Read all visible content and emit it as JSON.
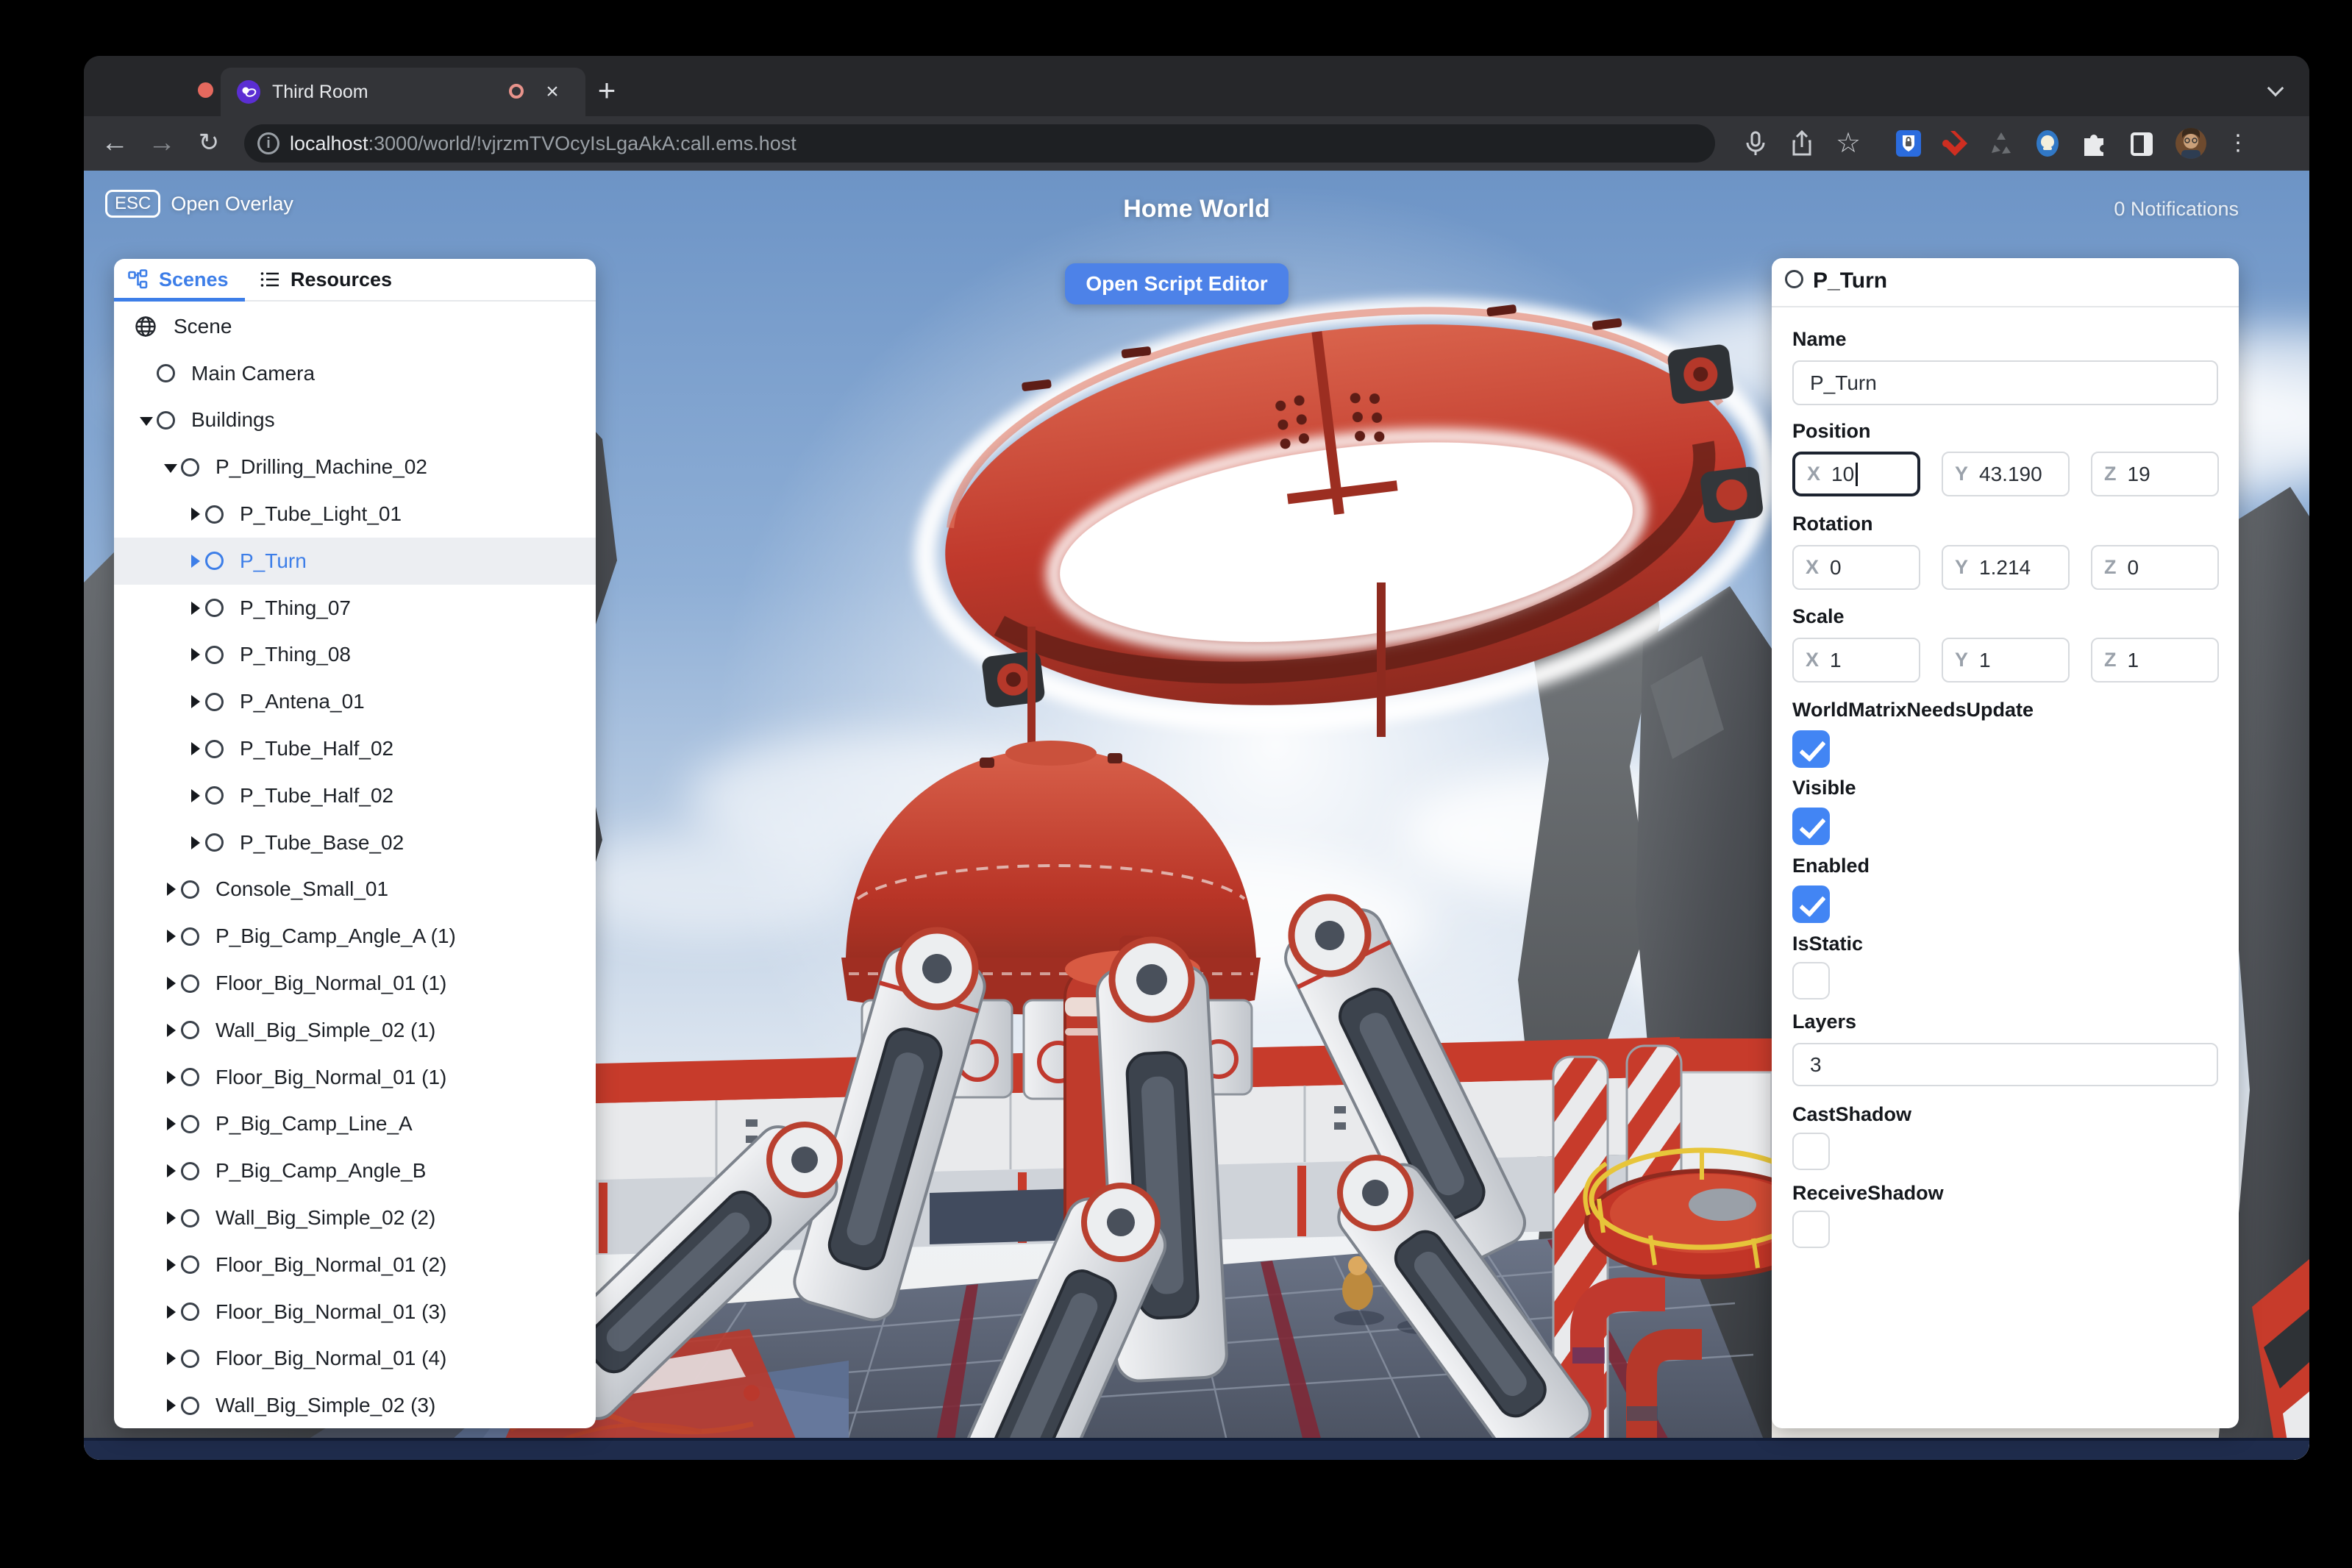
{
  "browser": {
    "tab_title": "Third Room",
    "close_tab_glyph": "×",
    "new_tab_glyph": "+",
    "back_glyph": "←",
    "forward_glyph": "→",
    "reload_glyph": "↻",
    "info_glyph": "i",
    "url_host": "localhost",
    "url_rest": ":3000/world/!vjrzmTVOcyIsLgaAkA:call.ems.host",
    "kebab_glyph": "⋮",
    "star_glyph": "☆",
    "toolbar_icon_names": [
      "microphone-icon",
      "share-icon",
      "bookmark-star-icon",
      "password-manager-icon",
      "red-extension-icon",
      "recycle-icon",
      "dark-mode-icon",
      "puzzle-extensions-icon",
      "side-panel-icon",
      "profile-avatar",
      "menu-kebab-icon"
    ]
  },
  "hud": {
    "esc_key": "ESC",
    "open_overlay_label": "Open Overlay",
    "world_title": "Home World",
    "notifications": "0 Notifications",
    "open_script_editor": "Open Script Editor"
  },
  "panel_tabs": {
    "scenes": "Scenes",
    "resources": "Resources"
  },
  "scene_tree": [
    {
      "label": "Scene",
      "level": 0,
      "icon": "globe",
      "caret": "none",
      "selected": false
    },
    {
      "label": "Main Camera",
      "level": 1,
      "caret": "none",
      "selected": false
    },
    {
      "label": "Buildings",
      "level": 1,
      "caret": "down",
      "selected": false
    },
    {
      "label": "P_Drilling_Machine_02",
      "level": 2,
      "caret": "down",
      "selected": false
    },
    {
      "label": "P_Tube_Light_01",
      "level": 3,
      "caret": "right",
      "selected": false
    },
    {
      "label": "P_Turn",
      "level": 3,
      "caret": "right",
      "selected": true
    },
    {
      "label": "P_Thing_07",
      "level": 3,
      "caret": "right",
      "selected": false
    },
    {
      "label": "P_Thing_08",
      "level": 3,
      "caret": "right",
      "selected": false
    },
    {
      "label": "P_Antena_01",
      "level": 3,
      "caret": "right",
      "selected": false
    },
    {
      "label": "P_Tube_Half_02",
      "level": 3,
      "caret": "right",
      "selected": false
    },
    {
      "label": "P_Tube_Half_02",
      "level": 3,
      "caret": "right",
      "selected": false
    },
    {
      "label": "P_Tube_Base_02",
      "level": 3,
      "caret": "right",
      "selected": false
    },
    {
      "label": "Console_Small_01",
      "level": 2,
      "caret": "right",
      "selected": false
    },
    {
      "label": "P_Big_Camp_Angle_A (1)",
      "level": 2,
      "caret": "right",
      "selected": false
    },
    {
      "label": "Floor_Big_Normal_01 (1)",
      "level": 2,
      "caret": "right",
      "selected": false
    },
    {
      "label": "Wall_Big_Simple_02 (1)",
      "level": 2,
      "caret": "right",
      "selected": false
    },
    {
      "label": "Floor_Big_Normal_01 (1)",
      "level": 2,
      "caret": "right",
      "selected": false
    },
    {
      "label": "P_Big_Camp_Line_A",
      "level": 2,
      "caret": "right",
      "selected": false
    },
    {
      "label": "P_Big_Camp_Angle_B",
      "level": 2,
      "caret": "right",
      "selected": false
    },
    {
      "label": "Wall_Big_Simple_02 (2)",
      "level": 2,
      "caret": "right",
      "selected": false
    },
    {
      "label": "Floor_Big_Normal_01 (2)",
      "level": 2,
      "caret": "right",
      "selected": false
    },
    {
      "label": "Floor_Big_Normal_01 (3)",
      "level": 2,
      "caret": "right",
      "selected": false
    },
    {
      "label": "Floor_Big_Normal_01 (4)",
      "level": 2,
      "caret": "right",
      "selected": false
    },
    {
      "label": "Wall_Big_Simple_02 (3)",
      "level": 2,
      "caret": "right",
      "selected": false
    }
  ],
  "inspector": {
    "header": "P_Turn",
    "axis": {
      "x": "X",
      "y": "Y",
      "z": "Z"
    },
    "fields": {
      "name": {
        "label": "Name",
        "value": "P_Turn"
      },
      "position": {
        "label": "Position",
        "x": "10",
        "y": "43.190",
        "z": "19",
        "focused_axis": "x"
      },
      "rotation": {
        "label": "Rotation",
        "x": "0",
        "y": "1.214",
        "z": "0"
      },
      "scale": {
        "label": "Scale",
        "x": "1",
        "y": "1",
        "z": "1"
      },
      "world_matrix_needs_update": {
        "label": "WorldMatrixNeedsUpdate",
        "checked": true
      },
      "visible": {
        "label": "Visible",
        "checked": true
      },
      "enabled": {
        "label": "Enabled",
        "checked": true
      },
      "is_static": {
        "label": "IsStatic",
        "checked": false
      },
      "layers": {
        "label": "Layers",
        "value": "3"
      },
      "cast_shadow": {
        "label": "CastShadow",
        "checked": false
      },
      "receive_shadow": {
        "label": "ReceiveShadow",
        "checked": false
      }
    }
  },
  "colors": {
    "accent_blue": "#4d82e8",
    "selection_blue": "#3d7ee8",
    "checkbox_blue": "#4285f4",
    "machine_red": "#c0392e",
    "panel_white": "#ffffff",
    "chrome_dark": "#26272a"
  }
}
